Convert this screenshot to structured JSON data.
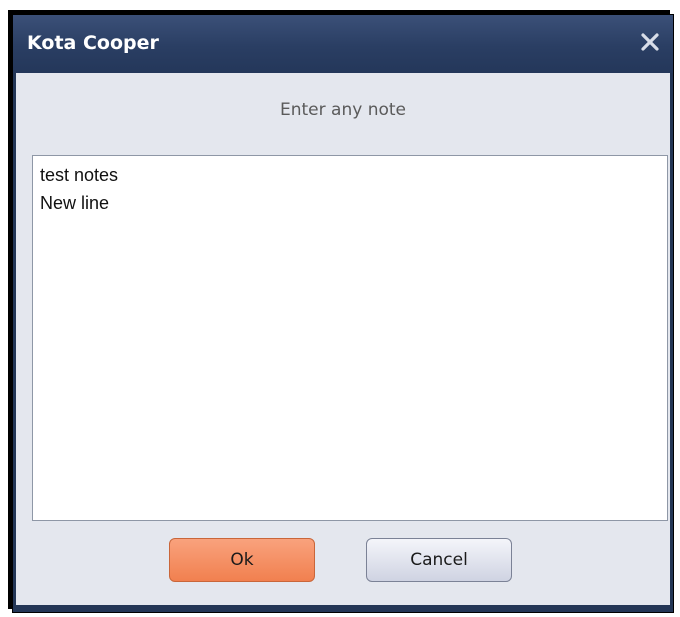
{
  "window": {
    "title": "Kota Cooper",
    "close_icon": "close-icon"
  },
  "dialog": {
    "prompt": "Enter any note",
    "note_lines": [
      "test notes",
      "New line"
    ]
  },
  "buttons": {
    "ok_label": "Ok",
    "cancel_label": "Cancel"
  },
  "colors": {
    "title_bar": "#2a3e63",
    "ok_button": "#f1804f",
    "content_background": "#e4e7ee"
  }
}
